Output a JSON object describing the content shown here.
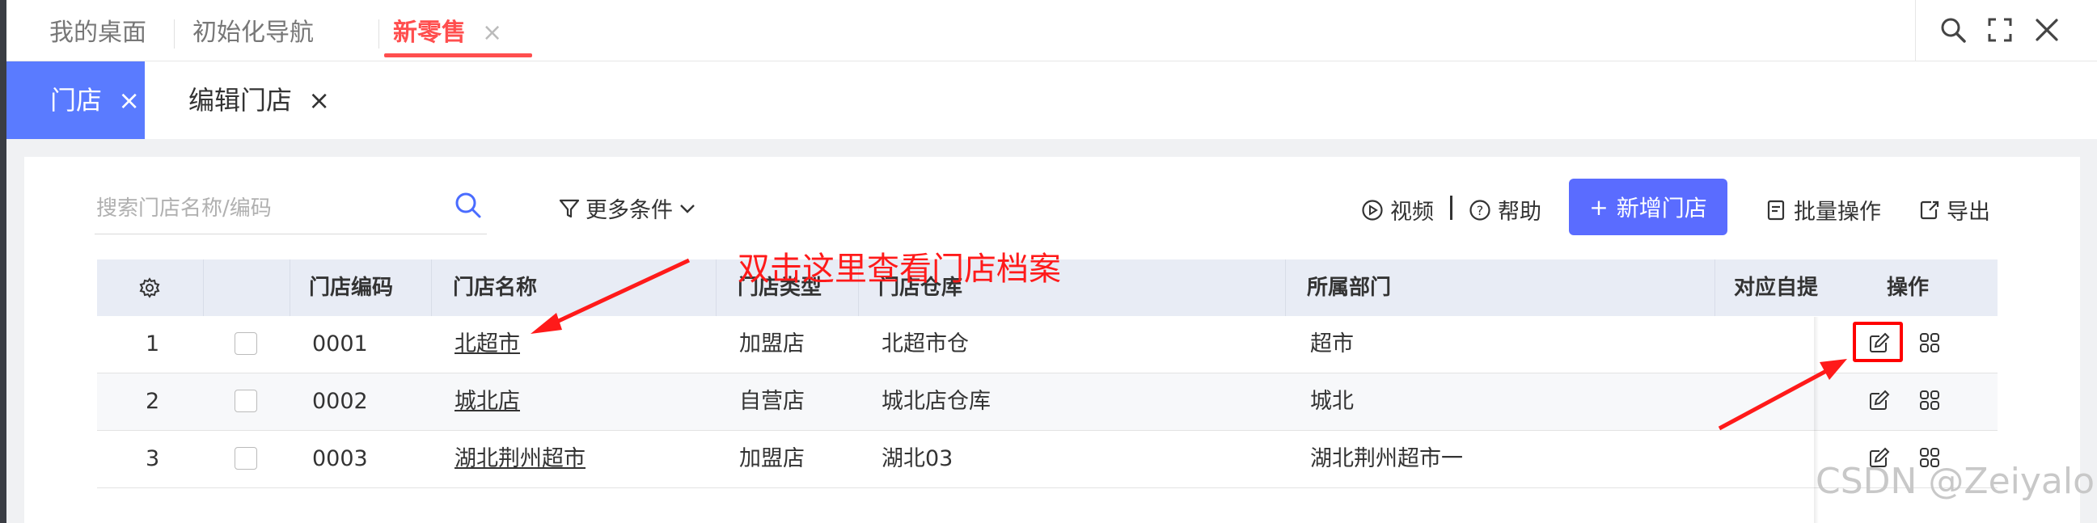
{
  "top_tabs": [
    {
      "label": "我的桌面"
    },
    {
      "label": "初始化导航"
    },
    {
      "label": "新零售",
      "close": "×"
    }
  ],
  "sub_tabs": [
    {
      "label": "门店",
      "close": "×"
    },
    {
      "label": "编辑门店",
      "close": "×"
    }
  ],
  "search": {
    "placeholder": "搜索门店名称/编码"
  },
  "filters": {
    "more_label": "更多条件"
  },
  "toolbar": {
    "video_label": "视频",
    "help_label": "帮助",
    "add_label": "新增门店",
    "add_prefix": "+",
    "batch_label": "批量操作",
    "export_label": "导出"
  },
  "table": {
    "columns": [
      "门店编码",
      "门店名称",
      "门店类型",
      "门店仓库",
      "所属部门",
      "对应自提",
      "操作"
    ],
    "rows": [
      {
        "index": "1",
        "code": "0001",
        "name": "北超市",
        "type": "加盟店",
        "warehouse": "北超市仓",
        "dept": "超市"
      },
      {
        "index": "2",
        "code": "0002",
        "name": "城北店",
        "type": "自营店",
        "warehouse": "城北店仓库",
        "dept": "城北"
      },
      {
        "index": "3",
        "code": "0003",
        "name": "湖北荆州超市",
        "type": "加盟店",
        "warehouse": "湖北03",
        "dept": "湖北荆州超市一"
      }
    ]
  },
  "annotation": {
    "text": "双击这里查看门店档案"
  },
  "watermark": "CSDN @Zeiyalo",
  "colors": {
    "accent_red": "#ff4e4e",
    "primary_blue": "#5a6cff",
    "tab_blue": "#5a7bff",
    "annotation_red": "#ff1a1a"
  }
}
